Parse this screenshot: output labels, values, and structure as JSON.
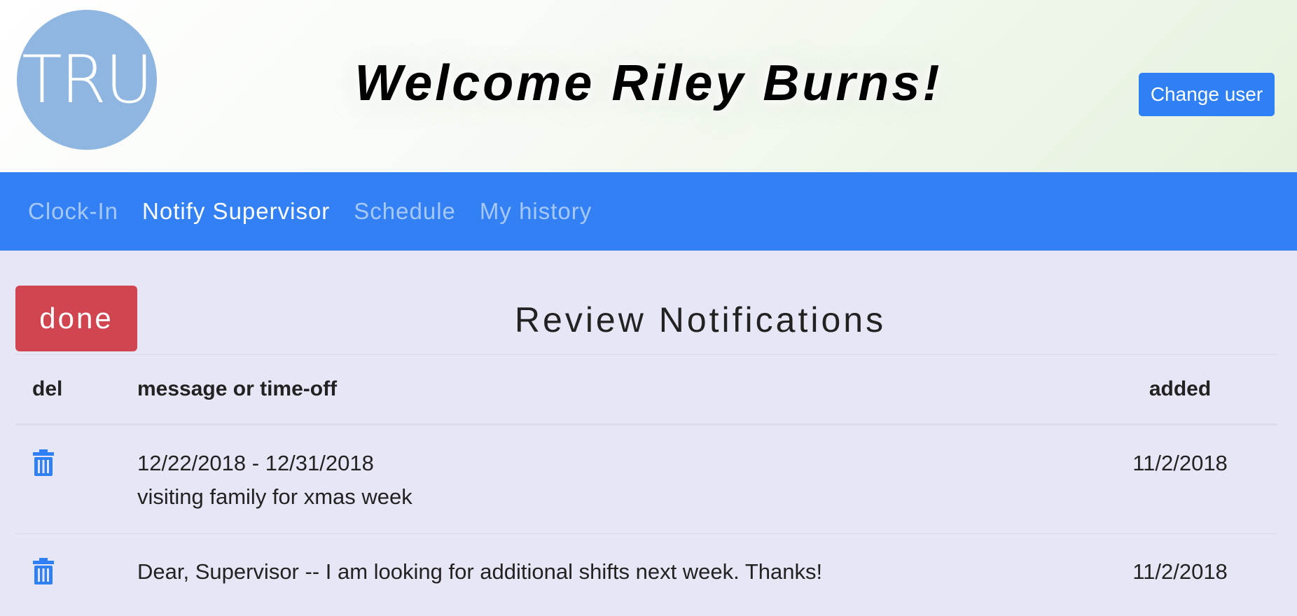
{
  "header": {
    "logo_text": "TRU",
    "welcome": "Welcome Riley Burns!",
    "change_user_label": "Change user"
  },
  "nav": {
    "items": [
      {
        "label": "Clock-In",
        "active": false
      },
      {
        "label": "Notify Supervisor",
        "active": true
      },
      {
        "label": "Schedule",
        "active": false
      },
      {
        "label": "My history",
        "active": false
      }
    ]
  },
  "main": {
    "done_label": "done",
    "title": "Review Notifications",
    "table": {
      "headers": {
        "del": "del",
        "message": "message or time-off",
        "added": "added"
      },
      "rows": [
        {
          "icon": "trash-icon",
          "line1": "12/22/2018 - 12/31/2018",
          "line2": "visiting family for xmas week",
          "added": "11/2/2018"
        },
        {
          "icon": "trash-icon",
          "line1": "Dear, Supervisor -- I am looking for additional shifts next week. Thanks!",
          "line2": "",
          "added": "11/2/2018"
        }
      ]
    }
  },
  "colors": {
    "nav_bg": "#3380f5",
    "accent": "#2f80f5",
    "done": "#d0454f",
    "logo": "#8fb6e0",
    "page_bg": "#e7e6f7"
  }
}
